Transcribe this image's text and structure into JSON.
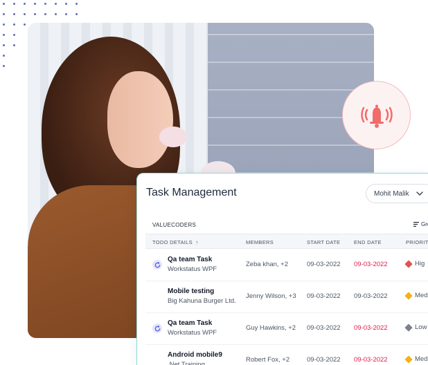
{
  "card": {
    "title": "Task Management",
    "user_select": "Mohit Malik",
    "org_label": "VALUECODERS",
    "group_label": "Gro"
  },
  "columns": {
    "todo": "TODO DETAILS",
    "sort_arrow": "↑",
    "members": "MEMBERS",
    "start": "START DATE",
    "end": "END DATE",
    "priority": "PRIORITY"
  },
  "rows": [
    {
      "name": "Qa team Task",
      "project": "Workstatus WPF",
      "members": "Zeba khan, +2",
      "start": "09-03-2022",
      "end": "09-03-2022",
      "priority": "Hig",
      "priority_color": "#e25252",
      "overdue": true,
      "has_icon": true
    },
    {
      "name": "Mobile testing",
      "project": "Big Kahuna Burger Ltd.",
      "members": "Jenny Wilson, +3",
      "start": "09-03-2022",
      "end": "09-03-2022",
      "priority": "Med",
      "priority_color": "#f2b21b",
      "overdue": false,
      "has_icon": false
    },
    {
      "name": "Qa team Task",
      "project": "Workstatus WPF",
      "members": "Guy Hawkins, +2",
      "start": "09-03-2022",
      "end": "09-03-2022",
      "priority": "Low",
      "priority_color": "#7c818b",
      "overdue": true,
      "has_icon": true
    },
    {
      "name": "Android mobile9",
      "project": ".Net Training",
      "members": "Robert Fox, +2",
      "start": "09-03-2022",
      "end": "09-03-2022",
      "priority": "Med",
      "priority_color": "#f2b21b",
      "overdue": true,
      "has_icon": false
    }
  ],
  "colors": {
    "accent": "#5b6fb0",
    "overdue": "#e11d48",
    "bell": "#f16b6b",
    "card_border": "#8fd6d3"
  },
  "icons": {
    "bell": "bell-ringing-icon",
    "chevron": "chevron-down-icon",
    "group": "filter-lines-icon",
    "task": "refresh-icon"
  }
}
